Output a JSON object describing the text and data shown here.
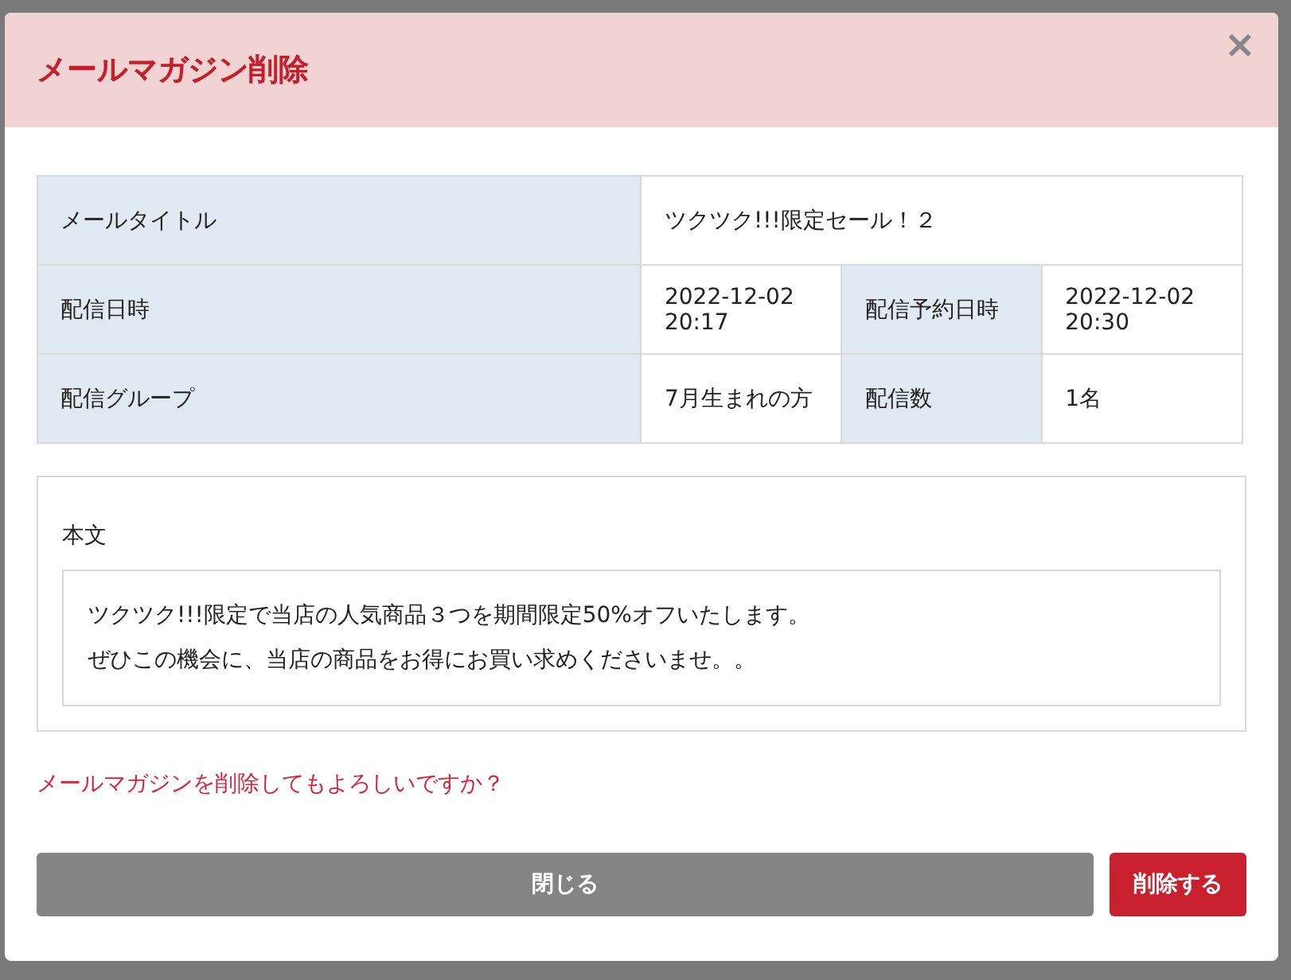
{
  "dialog": {
    "title": "メールマガジン削除",
    "close": "×",
    "details": [
      {
        "label": "メールタイトル",
        "value": "ツクツク!!!限定セール！２"
      },
      {
        "label": "配信日時",
        "value": "2022-12-02 20:17"
      },
      {
        "label": "配信予約日時",
        "value": "2022-12-02 20:30"
      },
      {
        "label": "配信グループ",
        "value": "7月生まれの方"
      },
      {
        "label": "配信数",
        "value": "1名"
      }
    ],
    "body": {
      "label": "本文",
      "lines": [
        "ツクツク!!!限定で当店の人気商品３つを期間限定50%オフいたします。",
        "ぜひこの機会に、当店の商品をお得にお買い求めくださいませ。。"
      ]
    },
    "confirm": "メールマガジンを削除してもよろしいですか？",
    "buttons": [
      {
        "label": "閉じる",
        "kind": "secondary"
      },
      {
        "label": "削除する",
        "kind": "danger"
      }
    ]
  }
}
